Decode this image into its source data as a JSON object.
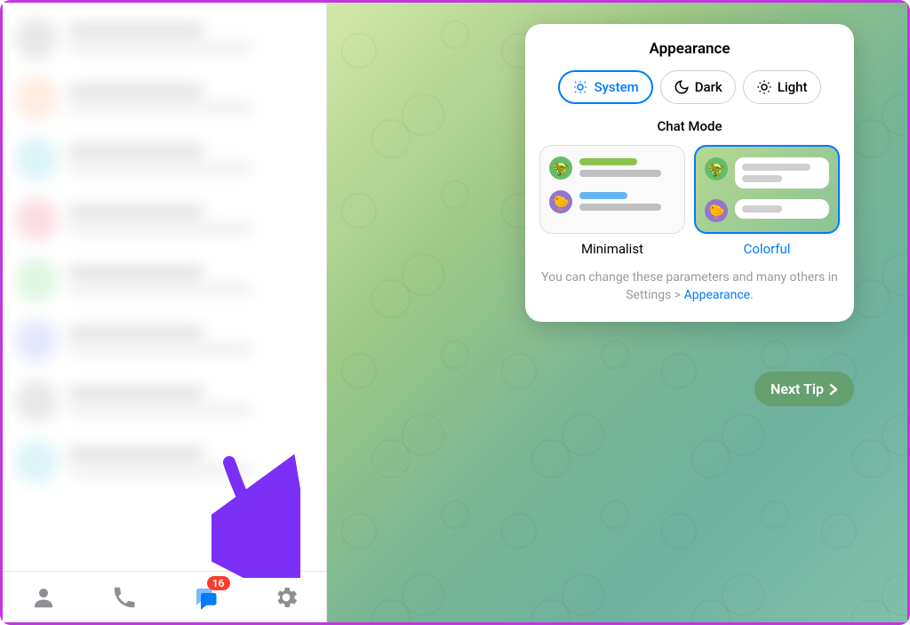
{
  "sidebar": {
    "chats": [
      {
        "color": "#8d8d8d"
      },
      {
        "color": "#ff9f6e"
      },
      {
        "color": "#4fc3d9"
      },
      {
        "color": "#e25b74"
      },
      {
        "color": "#5fd06c"
      },
      {
        "color": "#7a8bf0"
      },
      {
        "color": "#8d8d8d"
      },
      {
        "color": "#4fc3d9"
      }
    ],
    "tabs": {
      "contacts_icon": "contacts",
      "calls_icon": "calls",
      "chats_icon": "chats",
      "chats_badge": "16",
      "settings_icon": "settings"
    }
  },
  "tips": {
    "title": "Appearance",
    "themes": {
      "system": "System",
      "dark": "Dark",
      "light": "Light",
      "selected": "system"
    },
    "chat_mode_title": "Chat Mode",
    "modes": {
      "minimalist": "Minimalist",
      "colorful": "Colorful",
      "selected": "colorful"
    },
    "hint_pre": "You can change these parameters and many others in Settings > ",
    "hint_link": "Appearance",
    "hint_post": ".",
    "next_button": "Next Tip"
  }
}
